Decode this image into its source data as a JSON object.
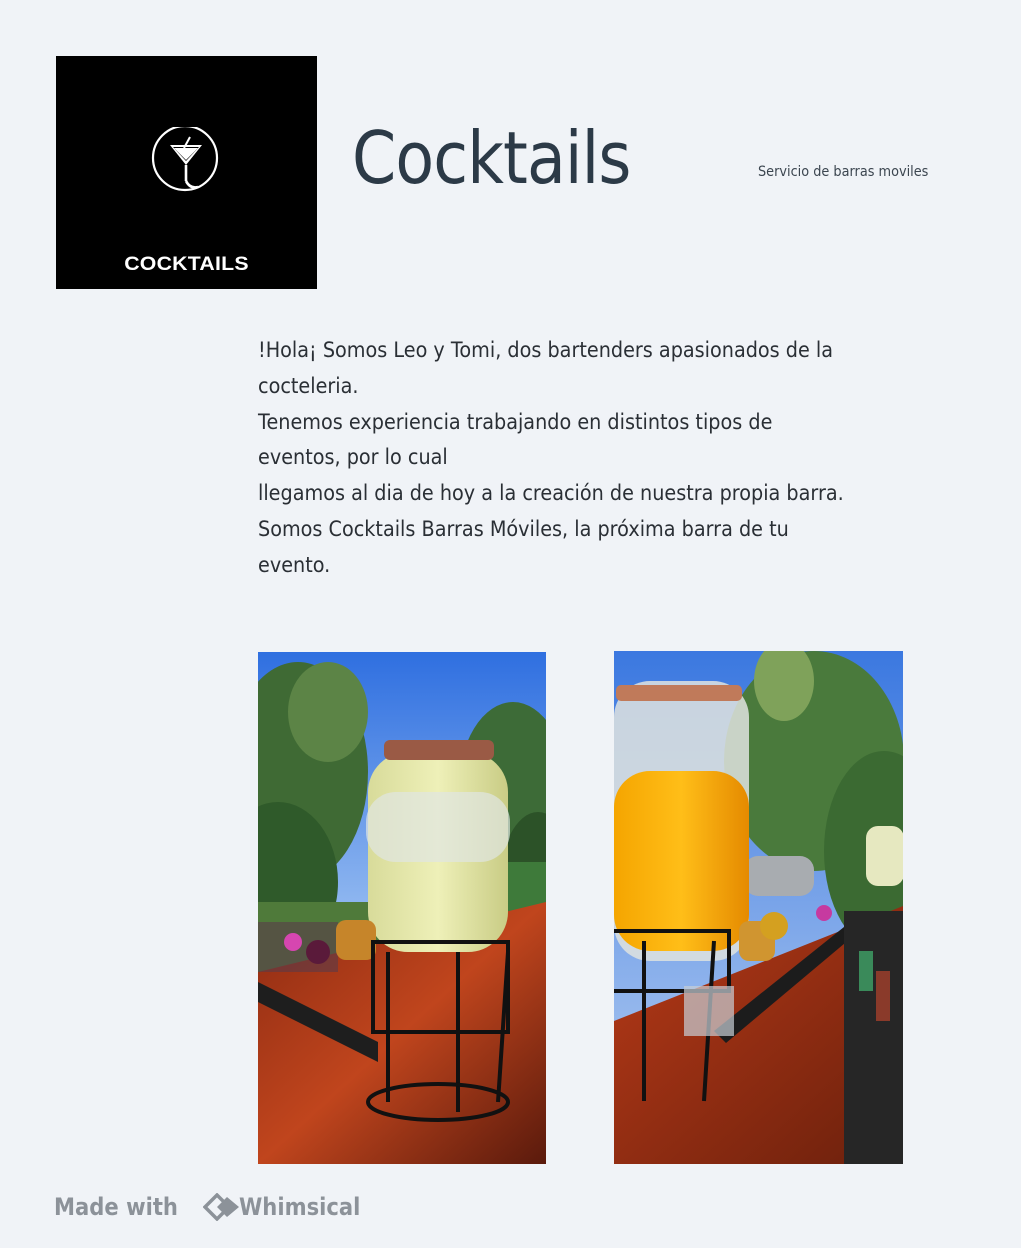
{
  "logo": {
    "text": "COCKTAILS",
    "icon": "martini-glass-icon"
  },
  "header": {
    "title": "Cocktails",
    "subtitle": "Servicio de barras moviles"
  },
  "intro": {
    "lines": [
      "!Hola¡ Somos Leo y Tomi, dos bartenders apasionados de la",
      "cocteleria.",
      "Tenemos experiencia trabajando en distintos tipos de",
      "eventos, por lo cual",
      "llegamos al dia de hoy a la creación de nuestra propia barra.",
      "Somos Cocktails Barras Móviles, la próxima barra de tu",
      "evento."
    ]
  },
  "photos": {
    "left": "lemonade-dispenser-photo",
    "right": "orange-juice-dispenser-photo"
  },
  "footer": {
    "made_with": "Made with",
    "brand": "Whimsical",
    "icon": "whimsical-logo-icon"
  },
  "colors": {
    "background": "#f0f3f7",
    "title": "#2c3a47",
    "logo_bg": "#000000",
    "footer_text": "#8c9299"
  }
}
